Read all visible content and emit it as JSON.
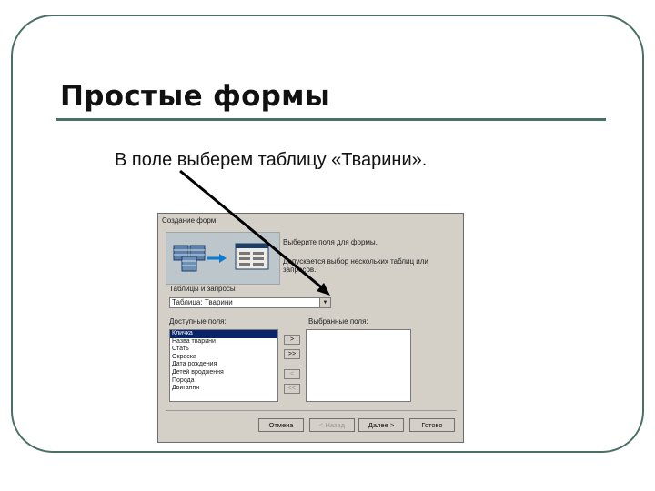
{
  "slide": {
    "title": "Простые формы",
    "body": "В поле  выберем таблицу «Тварини»."
  },
  "dialog": {
    "title": "Создание форм",
    "header_line1": "Выберите поля для формы.",
    "header_line2": "Допускается выбор нескольких таблиц или запросов.",
    "tables_label": "Таблицы и запросы",
    "table_value": "Таблица: Тварини",
    "available_label": "Доступные поля:",
    "selected_label": "Выбранные поля:",
    "available_fields": [
      "Кличка",
      "Назва тварини",
      "Стать",
      "Окраска",
      "Дата рождения",
      "Детей вродження",
      "Порода",
      "Двигання"
    ],
    "selected_fields": [],
    "btn_add": ">",
    "btn_add_all": ">>",
    "btn_remove": "<",
    "btn_remove_all": "<<",
    "btn_cancel": "Отмена",
    "btn_back": "< Назад",
    "btn_next": "Далее >",
    "btn_finish": "Готово"
  },
  "colors": {
    "frame": "#4a6f67",
    "dialog_bg": "#d4d0c8",
    "selection": "#0a246a"
  }
}
